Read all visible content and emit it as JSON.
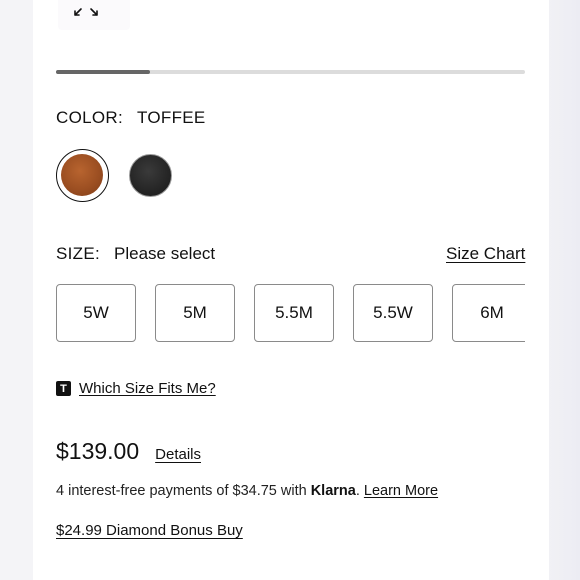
{
  "gallery": {
    "expand_icon": "expand-arrows-icon",
    "progress": 0.2
  },
  "color": {
    "label": "COLOR:",
    "selected": "TOFFEE",
    "swatches": [
      {
        "name": "Toffee",
        "hex": "#9c4f22",
        "selected": true
      },
      {
        "name": "Black",
        "hex": "#222222",
        "selected": false
      }
    ]
  },
  "size": {
    "label": "SIZE:",
    "value": "Please select",
    "chart_link": "Size Chart",
    "options": [
      "5W",
      "5M",
      "5.5M",
      "5.5W",
      "6M"
    ]
  },
  "fit": {
    "icon": "t-logo-icon",
    "link": "Which Size Fits Me?"
  },
  "pricing": {
    "price": "$139.00",
    "details_link": "Details",
    "klarna_prefix": "4 interest-free payments of $34.75 with ",
    "klarna_brand": "Klarna",
    "klarna_period": ". ",
    "learn_more": "Learn More",
    "bonus_link": "$24.99 Diamond Bonus Buy"
  }
}
